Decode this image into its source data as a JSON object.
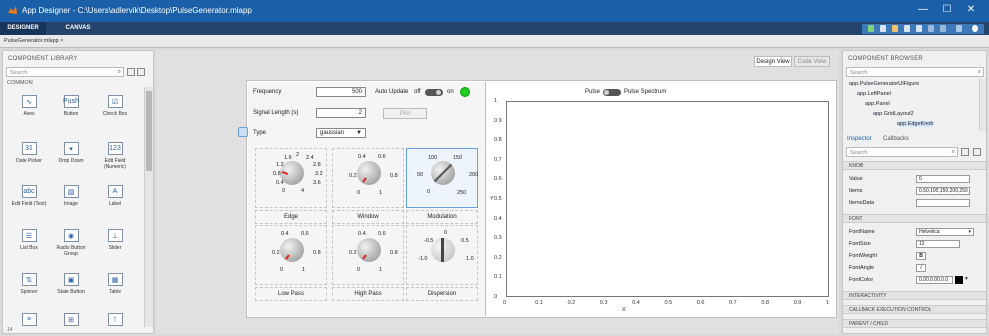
{
  "window": {
    "title": "App Designer - C:\\Users\\adlervik\\Desktop\\PulseGenerator.mlapp",
    "minimize": "—",
    "maximize": "☐",
    "close": "✕"
  },
  "ribbon": {
    "tabs": [
      "DESIGNER",
      "CANVAS"
    ]
  },
  "file_tab": "PulseGenerator.mlapp  ×",
  "component_library": {
    "header": "COMPONENT LIBRARY",
    "search_placeholder": "Search",
    "section": "COMMON",
    "items": [
      {
        "label": "Axes",
        "icon": "axes-icon",
        "glyph": "∿"
      },
      {
        "label": "Button",
        "icon": "button-icon",
        "glyph": "Push"
      },
      {
        "label": "Check Box",
        "icon": "checkbox-icon",
        "glyph": "☑"
      },
      {
        "label": "Date Picker",
        "icon": "calendar-icon",
        "glyph": "31"
      },
      {
        "label": "Drop Down",
        "icon": "dropdown-icon",
        "glyph": "▾"
      },
      {
        "label": "Edit Field (Numeric)",
        "icon": "numeric-field-icon",
        "glyph": "123"
      },
      {
        "label": "Edit Field (Text)",
        "icon": "text-field-icon",
        "glyph": "abc"
      },
      {
        "label": "Image",
        "icon": "image-icon",
        "glyph": "▨"
      },
      {
        "label": "Label",
        "icon": "label-icon",
        "glyph": "A"
      },
      {
        "label": "List Box",
        "icon": "listbox-icon",
        "glyph": "☰"
      },
      {
        "label": "Radio Button Group",
        "icon": "radio-group-icon",
        "glyph": "◉"
      },
      {
        "label": "Slider",
        "icon": "slider-icon",
        "glyph": "⊥"
      },
      {
        "label": "Spinner",
        "icon": "spinner-icon",
        "glyph": "⇅"
      },
      {
        "label": "State Button",
        "icon": "state-button-icon",
        "glyph": "▣"
      },
      {
        "label": "Table",
        "icon": "table-icon",
        "glyph": "▦"
      },
      {
        "label": "",
        "icon": "textarea-icon",
        "glyph": "≡"
      },
      {
        "label": "",
        "icon": "tree-icon",
        "glyph": "⊞"
      },
      {
        "label": "",
        "icon": "toggle-icon",
        "glyph": "⊺"
      }
    ],
    "status": "14"
  },
  "canvas": {
    "view_buttons": [
      "Design View",
      "Code View"
    ],
    "frequency_label": "Frequency",
    "frequency_value": "500",
    "auto_update_label": "Auto Update",
    "off_label": "off",
    "on_label": "on",
    "signal_length_label": "Signal Length (s)",
    "signal_length_value": "2",
    "plot_button": "Plot",
    "type_label": "Type",
    "type_value": "gaussian",
    "pulse_label": "Pulse",
    "pulse_spectrum_label": "Pulse Spectrum",
    "knobs": [
      {
        "caption": "Edge",
        "ticks": [
          "1.6",
          "2",
          "2.4",
          "1.2",
          "2.8",
          "0.8",
          "3.2",
          "0.4",
          "3.6",
          "0",
          "4"
        ]
      },
      {
        "caption": "Window",
        "ticks": [
          "0.4",
          "0.6",
          "0.2",
          "0.8",
          "0",
          "1"
        ]
      },
      {
        "caption": "Modulation",
        "ticks": [
          "100",
          "150",
          "50",
          "200",
          "0",
          "250"
        ]
      },
      {
        "caption": "Low Pass",
        "ticks": [
          "0.4",
          "0.6",
          "0.2",
          "0.8",
          "0",
          "1"
        ]
      },
      {
        "caption": "High Pass",
        "ticks": [
          "0.4",
          "0.6",
          "0.2",
          "0.8",
          "0",
          "1"
        ]
      },
      {
        "caption": "Dispersion",
        "ticks": [
          "0",
          "-0.5",
          "0.5",
          "-1.0",
          "1.0"
        ]
      }
    ],
    "plot": {
      "y_ticks": [
        "1",
        "0.9",
        "0.8",
        "0.7",
        "0.6",
        "0.5",
        "0.4",
        "0.3",
        "0.2",
        "0.1",
        "0"
      ],
      "x_ticks": [
        "0",
        "0.1",
        "0.2",
        "0.3",
        "0.4",
        "0.5",
        "0.6",
        "0.7",
        "0.8",
        "0.9",
        "1"
      ],
      "x_label": "X",
      "y_label": "Y"
    }
  },
  "component_browser": {
    "header": "COMPONENT BROWSER",
    "search_placeholder": "Search",
    "tree": [
      "app.PulseGeneratorUIFigure",
      "app.LeftPanel",
      "app.Panel",
      "app.GridLayout2",
      "app.EdgeKnob"
    ],
    "tabs": [
      "Inspector",
      "Callbacks"
    ],
    "inspector_search": "Search",
    "knob_section": "KNOB",
    "knob_props": [
      {
        "name": "Value",
        "value": "0"
      },
      {
        "name": "Items",
        "value": "0,50,100,150,200,250"
      },
      {
        "name": "ItemsData",
        "value": ""
      }
    ],
    "font_section": "FONT",
    "font_props": [
      {
        "name": "FontName",
        "value": "Helvetica"
      },
      {
        "name": "FontSize",
        "value": "12"
      },
      {
        "name": "FontWeight",
        "value": "B"
      },
      {
        "name": "FontAngle",
        "value": "I"
      },
      {
        "name": "FontColor",
        "value": "0.00,0.00,0.0"
      }
    ],
    "collapsed_sections": [
      "INTERACTIVITY",
      "CALLBACK EXECUTION CONTROL",
      "PARENT / CHILD"
    ]
  },
  "colors": {
    "accent": "#1a5fa8",
    "ribbon": "#24446d",
    "lamp": "#22cc22"
  }
}
